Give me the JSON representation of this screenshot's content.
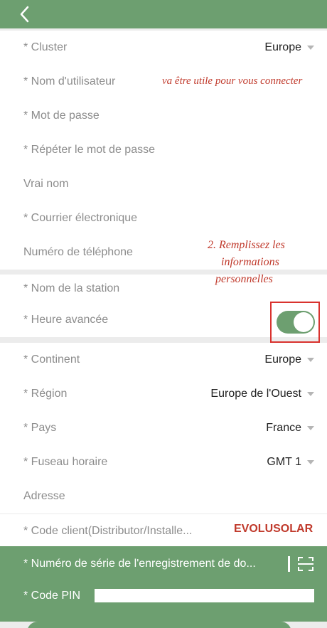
{
  "form": {
    "cluster_label": "* Cluster",
    "cluster_value": "Europe",
    "username_label": "* Nom d'utilisateur",
    "username_hint": "va être utile pour vous connecter",
    "password_label": "* Mot de passe",
    "repeat_password_label": "* Répéter le mot de passe",
    "real_name_label": "Vrai nom",
    "email_label": "* Courrier électronique",
    "phone_label": "Numéro de téléphone",
    "step_note_line1": "2. Remplissez les",
    "step_note_line2": "informations",
    "step_note_line3": "personnelles",
    "station_name_label": "* Nom de la station",
    "dst_label": "* Heure avancée",
    "dst_enabled": true,
    "continent_label": "* Continent",
    "continent_value": "Europe",
    "region_label": "* Région",
    "region_value": "Europe de l'Ouest",
    "country_label": "* Pays",
    "country_value": "France",
    "timezone_label": "* Fuseau horaire",
    "timezone_value": "GMT 1",
    "address_label": "Adresse",
    "client_code_label": "* Code client(Distributor/Installe...",
    "client_code_value": "EVOLUSOLAR",
    "serial_label": "* Numéro de série de l'enregistrement de do...",
    "pin_label": "* Code PIN"
  },
  "colors": {
    "accent_green": "#6d9f70",
    "annotation_red": "#c0392b",
    "highlight_box": "#d9322e"
  },
  "icons": {
    "back": "chevron-left-icon",
    "dropdown": "caret-down-icon",
    "scan": "scan-icon"
  }
}
